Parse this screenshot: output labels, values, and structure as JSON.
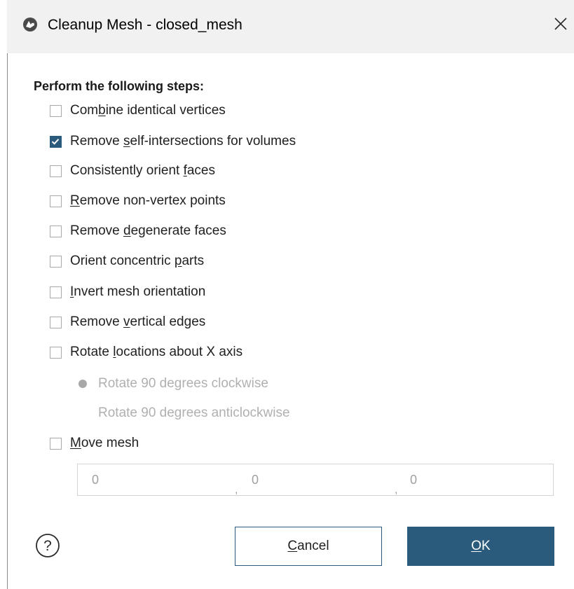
{
  "window": {
    "title": "Cleanup Mesh - closed_mesh"
  },
  "section": {
    "label": "Perform the following steps:"
  },
  "options": [
    {
      "pre": "Com",
      "key": "b",
      "post": "ine identical vertices",
      "checked": false
    },
    {
      "pre": "Remove ",
      "key": "s",
      "post": "elf-intersections for volumes",
      "checked": true
    },
    {
      "pre": "Consistently orient ",
      "key": "f",
      "post": "aces",
      "checked": false
    },
    {
      "pre": "",
      "key": "R",
      "post": "emove non-vertex points",
      "checked": false
    },
    {
      "pre": "Remove ",
      "key": "d",
      "post": "egenerate faces",
      "checked": false
    },
    {
      "pre": "Orient concentric ",
      "key": "p",
      "post": "arts",
      "checked": false
    },
    {
      "pre": "",
      "key": "I",
      "post": "nvert mesh orientation",
      "checked": false
    },
    {
      "pre": "Remove ",
      "key": "v",
      "post": "ertical edges",
      "checked": false
    },
    {
      "pre": "Rotate ",
      "key": "l",
      "post": "ocations about X axis",
      "checked": false
    }
  ],
  "rotation": {
    "options": [
      {
        "label": "Rotate 90 degrees clockwise",
        "selected": true
      },
      {
        "label": "Rotate 90 degrees anticlockwise",
        "selected": false
      }
    ]
  },
  "move_mesh": {
    "pre": "",
    "key": "M",
    "post": "ove mesh",
    "checked": false,
    "x": "0",
    "y": "0",
    "z": "0",
    "separator": ","
  },
  "buttons": {
    "cancel_key": "C",
    "cancel_rest": "ancel",
    "ok_key": "O",
    "ok_rest": "K"
  },
  "colors": {
    "accent": "#2a5b7d",
    "title_bar": "#f1f1f1",
    "disabled_text": "#b0b0b0"
  }
}
